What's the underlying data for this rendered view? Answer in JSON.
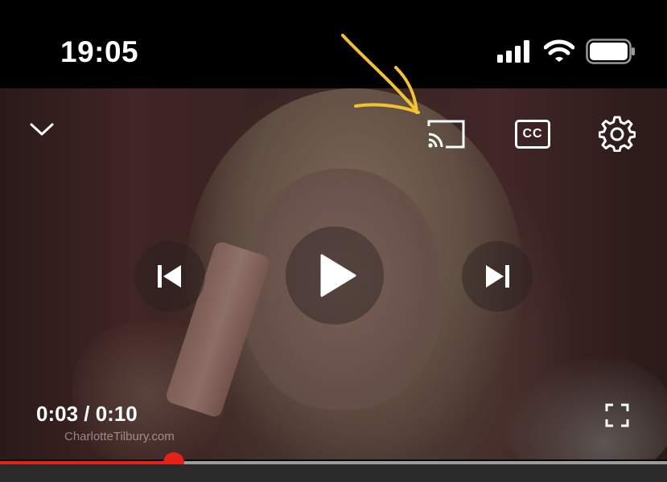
{
  "status_bar": {
    "time": "19:05",
    "icons": [
      "cellular-signal-icon",
      "wifi-icon",
      "battery-icon"
    ]
  },
  "player": {
    "current_time": "0:03",
    "separator": " / ",
    "duration": "0:10",
    "progress_fraction": 0.26,
    "watermark": "CharlotteTilbury.com",
    "colors": {
      "progress": "#e62117",
      "track": "#9c9c9c",
      "annotation": "#f2c230"
    },
    "controls": [
      "minimize-chevron-icon",
      "cast-icon",
      "captions-icon",
      "settings-gear-icon",
      "previous-icon",
      "play-icon",
      "next-icon",
      "fullscreen-icon"
    ],
    "captions_label": "CC"
  }
}
